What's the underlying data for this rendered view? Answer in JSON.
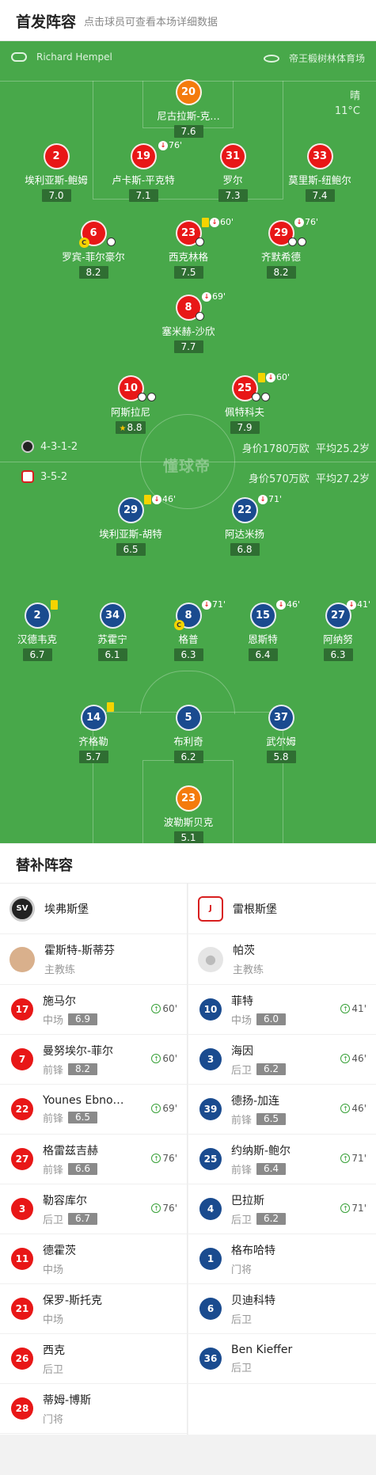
{
  "header": {
    "title": "首发阵容",
    "subtitle": "点击球员可查看本场详细数据"
  },
  "match": {
    "referee": "Richard Hempel",
    "venue": "帝王椴树林体育场",
    "weather": "晴",
    "temp": "11°C",
    "watermark": "懂球帝"
  },
  "colors": {
    "home": "#e81717",
    "away": "#1a4b8f",
    "gk": "#f47b0c",
    "pitch": "#48a84a"
  },
  "home": {
    "formation": "4-3-1-2",
    "value": "身价1780万欧",
    "age": "平均25.2岁",
    "players": [
      {
        "num": "20",
        "name": "尼古拉斯-克…",
        "rating": "7.6"
      },
      {
        "num": "2",
        "name": "埃利亚斯-鲍姆",
        "rating": "7.0"
      },
      {
        "num": "19",
        "name": "卢卡斯-平克特",
        "rating": "7.1",
        "sub": "76'"
      },
      {
        "num": "31",
        "name": "罗尔",
        "rating": "7.3"
      },
      {
        "num": "33",
        "name": "莫里斯-纽鲍尔",
        "rating": "7.4"
      },
      {
        "num": "6",
        "name": "罗宾-菲尔豪尔",
        "rating": "8.2"
      },
      {
        "num": "23",
        "name": "西克林格",
        "rating": "7.5",
        "sub": "60'"
      },
      {
        "num": "29",
        "name": "齐默希德",
        "rating": "8.2",
        "sub": "76'"
      },
      {
        "num": "8",
        "name": "塞米赫-沙欣",
        "rating": "7.7",
        "sub": "69'"
      },
      {
        "num": "10",
        "name": "阿斯拉尼",
        "rating": "8.8"
      },
      {
        "num": "25",
        "name": "佩特科夫",
        "rating": "7.9",
        "sub": "60'"
      }
    ]
  },
  "away": {
    "formation": "3-5-2",
    "value": "身价570万欧",
    "age": "平均27.2岁",
    "players": [
      {
        "num": "29",
        "name": "埃利亚斯-胡特",
        "rating": "6.5",
        "sub": "46'"
      },
      {
        "num": "22",
        "name": "阿达米扬",
        "rating": "6.8",
        "sub": "71'"
      },
      {
        "num": "2",
        "name": "汉德韦克",
        "rating": "6.7"
      },
      {
        "num": "34",
        "name": "苏霍宁",
        "rating": "6.1"
      },
      {
        "num": "8",
        "name": "格普",
        "rating": "6.3",
        "sub": "71'"
      },
      {
        "num": "15",
        "name": "恩斯特",
        "rating": "6.4",
        "sub": "46'"
      },
      {
        "num": "27",
        "name": "阿纳努",
        "rating": "6.3",
        "sub": "41'"
      },
      {
        "num": "14",
        "name": "齐格勒",
        "rating": "5.7"
      },
      {
        "num": "5",
        "name": "布利奇",
        "rating": "6.2"
      },
      {
        "num": "37",
        "name": "武尔姆",
        "rating": "5.8"
      },
      {
        "num": "23",
        "name": "波勒斯贝克",
        "rating": "5.1"
      }
    ]
  },
  "subs": {
    "title": "替补阵容",
    "home_team": "埃弗斯堡",
    "away_team": "雷根斯堡",
    "home_coach": {
      "name": "霍斯特-斯蒂芬",
      "role": "主教练"
    },
    "away_coach": {
      "name": "帕茨",
      "role": "主教练"
    },
    "home": [
      {
        "num": "17",
        "name": "施马尔",
        "pos": "中场",
        "rating": "6.9",
        "time": "60'"
      },
      {
        "num": "7",
        "name": "曼努埃尔-菲尔",
        "pos": "前锋",
        "rating": "8.2",
        "time": "60'"
      },
      {
        "num": "22",
        "name": "Younes Ebno…",
        "pos": "前锋",
        "rating": "6.5",
        "time": "69'"
      },
      {
        "num": "27",
        "name": "格雷兹吉赫",
        "pos": "前锋",
        "rating": "6.6",
        "time": "76'"
      },
      {
        "num": "3",
        "name": "勒容库尔",
        "pos": "后卫",
        "rating": "6.7",
        "time": "76'"
      },
      {
        "num": "11",
        "name": "德霍茨",
        "pos": "中场"
      },
      {
        "num": "21",
        "name": "保罗-斯托克",
        "pos": "中场"
      },
      {
        "num": "26",
        "name": "西克",
        "pos": "后卫"
      },
      {
        "num": "28",
        "name": "蒂姆-博斯",
        "pos": "门将"
      }
    ],
    "away": [
      {
        "num": "10",
        "name": "菲特",
        "pos": "中场",
        "rating": "6.0",
        "time": "41'"
      },
      {
        "num": "3",
        "name": "海因",
        "pos": "后卫",
        "rating": "6.2",
        "time": "46'"
      },
      {
        "num": "39",
        "name": "德扬-加连",
        "pos": "前锋",
        "rating": "6.5",
        "time": "46'"
      },
      {
        "num": "25",
        "name": "约纳斯-鲍尔",
        "pos": "前锋",
        "rating": "6.4",
        "time": "71'"
      },
      {
        "num": "4",
        "name": "巴拉斯",
        "pos": "后卫",
        "rating": "6.2",
        "time": "71'"
      },
      {
        "num": "1",
        "name": "格布哈特",
        "pos": "门将"
      },
      {
        "num": "6",
        "name": "贝迪科特",
        "pos": "后卫"
      },
      {
        "num": "36",
        "name": "Ben Kieffer",
        "pos": "后卫"
      }
    ]
  }
}
